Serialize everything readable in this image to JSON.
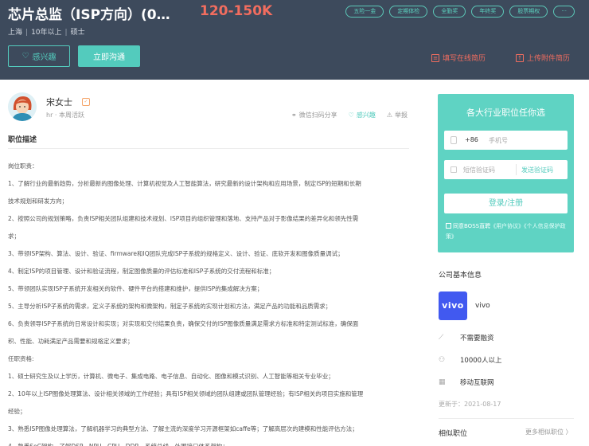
{
  "job": {
    "title": "芯片总监（ISP方向）(0…",
    "salary": "120-150K",
    "city": "上海",
    "experience": "10年以上",
    "education": "硕士"
  },
  "tags": [
    "五险一金",
    "定期体检",
    "全勤奖",
    "年终奖",
    "股票期权",
    "···"
  ],
  "actions": {
    "interest_label": "感兴趣",
    "chat_label": "立即沟通",
    "online_resume": "填写在线简历",
    "upload_resume": "上传附件简历"
  },
  "recruiter": {
    "name": "宋女士",
    "role": "hr",
    "status": "本周活跃"
  },
  "ops": {
    "wechat_share": "微信扫码分享",
    "interest": "感兴趣",
    "report": "举报"
  },
  "description": {
    "section_title": "职位描述",
    "lines": [
      "岗位职责：",
      "1、了解行业的最新趋势，分析最新的图像处理、计算机视觉及人工智能算法，研究最新的设计架构和应用场景，制定ISP的短期和长期",
      "技术规划和研发方向；",
      "2、按照公司的规划策略，负责ISP相关团队组建和技术规划、ISP项目的组织管理和落地、支持产品对于影像结果的差异化和领先性需",
      "求；",
      "3、带领ISP架构、算法、设计、验证、firmware和IQ团队完成ISP子系统的规格定义、设计、验证、底软开发和图像质量调试；",
      "4、制定ISP的项目管理、设计和验证流程，制定图像质量的评估标准和ISP子系统的交付流程和标准；",
      "5、带领团队实现ISP子系统开发相关的软件、硬件平台的搭建和维护，提供ISP的集成解决方案；",
      "5、主导分析ISP子系统的需求，定义子系统的架构和微架构，制定子系统的实现计划和方法，满足产品的功能和品质需求；",
      "6、负责领导ISP子系统的日常设计和实现；对实现和交付结果负责，确保交付的ISP图像质量满足需求方标准和特定测试标准，确保面",
      "积、性能、功耗满足产品需要和规格定义要求；",
      "任职资格:",
      "1、硕士研究生及以上学历，计算机、微电子、集成电路、电子信息、自动化、图像和模式识别、人工智能等相关专业毕业；",
      "2、10年以上ISP图像处理算法、设计相关领域的工作经验；具有ISP相关领域的团队组建或团队管理经验；有ISP相关的项目实施和管理",
      "经验；",
      "3、熟悉ISP图像处理算法，了解机器学习的典型方法、了解主流的深度学习开源框架如caffe等；了解高层次的建模和性能评估方法；",
      "4、熟悉SoC架构，了解DSP、NPU、CPU、DDR、系统总线、外围接口体系架构；"
    ]
  },
  "login": {
    "title": "各大行业职位任你选",
    "country_code": "+86",
    "phone_placeholder": "手机号",
    "code_placeholder": "短信验证码",
    "send_code": "发送验证码",
    "submit": "登录/注册",
    "agree_prefix": "同意BOSS直聘",
    "agree_link1": "《用户协议》",
    "agree_link2": "《个人信息保护政策》"
  },
  "company": {
    "heading": "公司基本信息",
    "logo_text": "vivo",
    "name": "vivo",
    "financing": "不需要融资",
    "size": "10000人以上",
    "industry": "移动互联网",
    "updated": "更新于：2021-08-17"
  },
  "similar": {
    "heading": "相似职位",
    "more": "更多相似职位 〉"
  },
  "colors": {
    "banner": "#3d4a5c",
    "accent": "#53cbbd",
    "salary": "#f26d5f",
    "card": "#5fd3c3",
    "vivo": "#4159f0"
  }
}
